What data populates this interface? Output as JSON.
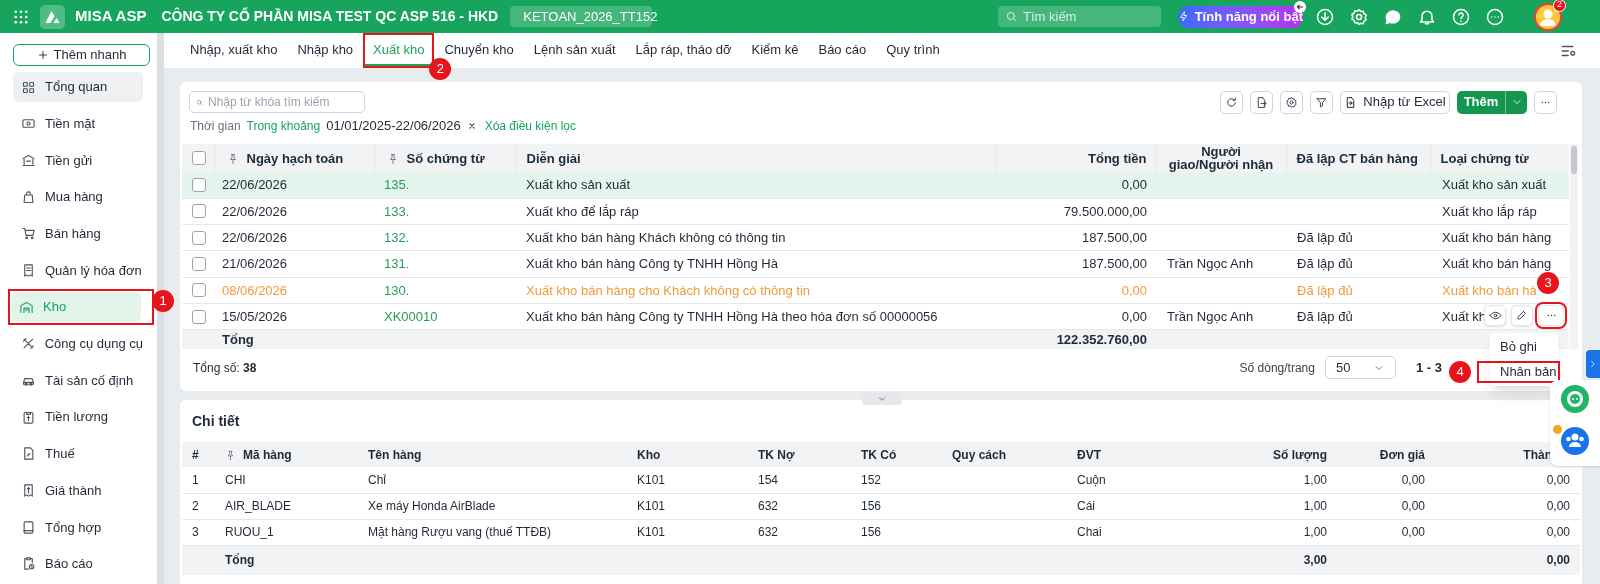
{
  "header": {
    "app_name": "MISA ASP",
    "company": "CÔNG TY CỔ PHẦN MISA TEST QC ASP 516 - HKD",
    "database": "KETOAN_2026_TT152",
    "search": {
      "placeholder": "Tìm kiếm"
    },
    "feature_button": "Tính năng nổi bật",
    "notification_count": "2"
  },
  "sidebar": {
    "quick_add": "Thêm nhanh",
    "items": [
      {
        "label": "Tổng quan",
        "selected": false,
        "hovered": true
      },
      {
        "label": "Tiền mặt",
        "selected": false,
        "hovered": false
      },
      {
        "label": "Tiền gửi",
        "selected": false,
        "hovered": false
      },
      {
        "label": "Mua hàng",
        "selected": false,
        "hovered": false
      },
      {
        "label": "Bán hàng",
        "selected": false,
        "hovered": false
      },
      {
        "label": "Quản lý hóa đơn",
        "selected": false,
        "hovered": false
      },
      {
        "label": "Kho",
        "selected": true,
        "hovered": false,
        "callout": "1"
      },
      {
        "label": "Công cụ dụng cụ",
        "selected": false,
        "hovered": false
      },
      {
        "label": "Tài sản cố định",
        "selected": false,
        "hovered": false
      },
      {
        "label": "Tiền lương",
        "selected": false,
        "hovered": false
      },
      {
        "label": "Thuế",
        "selected": false,
        "hovered": false
      },
      {
        "label": "Giá thành",
        "selected": false,
        "hovered": false
      },
      {
        "label": "Tổng hợp",
        "selected": false,
        "hovered": false
      },
      {
        "label": "Báo cáo",
        "selected": false,
        "hovered": false
      }
    ]
  },
  "tabs": [
    {
      "label": "Nhập, xuất kho",
      "selected": false
    },
    {
      "label": "Nhập kho",
      "selected": false
    },
    {
      "label": "Xuất kho",
      "selected": true,
      "callout": "2"
    },
    {
      "label": "Chuyển kho",
      "selected": false
    },
    {
      "label": "Lệnh sản xuất",
      "selected": false
    },
    {
      "label": "Lắp ráp, tháo dỡ",
      "selected": false
    },
    {
      "label": "Kiểm kê",
      "selected": false
    },
    {
      "label": "Báo cáo",
      "selected": false
    },
    {
      "label": "Quy trình",
      "selected": false
    }
  ],
  "toolbar": {
    "search": {
      "placeholder": "Nhập từ khóa tìm kiếm"
    },
    "import_button": "Nhập từ Excel",
    "add_button": "Thêm"
  },
  "filter": {
    "label": "Thời gian",
    "mode": "Trong khoảng",
    "range": "01/01/2025-22/06/2026",
    "clear": "Xóa điều kiện lọc"
  },
  "vouchers": {
    "all_checked": false,
    "columns": [
      "Ngày hạch toán",
      "Số chứng từ",
      "Diễn giải",
      "Tổng tiền",
      "Người giao/Người nhận",
      "Đã lập CT bán hàng",
      "Loại chứng từ"
    ],
    "rows": [
      {
        "date": "22/06/2026",
        "number": "135.",
        "description": "Xuất kho sản xuất",
        "amount": "0,00",
        "receiver": "",
        "sales_status": "",
        "type": "Xuất kho sản xuất",
        "selected": true,
        "checked": false,
        "kind": "normal"
      },
      {
        "date": "22/06/2026",
        "number": "133.",
        "description": "Xuất kho để lắp ráp",
        "amount": "79.500.000,00",
        "receiver": "",
        "sales_status": "",
        "type": "Xuất kho lắp ráp",
        "selected": false,
        "checked": false,
        "kind": "normal"
      },
      {
        "date": "22/06/2026",
        "number": "132.",
        "description": "Xuất kho bán hàng Khách không có thông tin",
        "amount": "187.500,00",
        "receiver": "",
        "sales_status": "Đã lập đủ",
        "type": "Xuất kho bán hàng",
        "selected": false,
        "checked": false,
        "kind": "normal"
      },
      {
        "date": "21/06/2026",
        "number": "131.",
        "description": "Xuất kho bán hàng Công ty TNHH Hồng Hà",
        "amount": "187.500,00",
        "receiver": "Trần Ngọc Anh",
        "sales_status": "Đã lập đủ",
        "type": "Xuất kho bán hàng",
        "selected": false,
        "checked": false,
        "kind": "normal"
      },
      {
        "date": "08/06/2026",
        "number": "130.",
        "description": "Xuất kho bán hàng cho Khách không có thông tin",
        "amount": "0,00",
        "receiver": "",
        "sales_status": "Đã lập đủ",
        "type": "Xuất kho bán hà",
        "selected": false,
        "checked": false,
        "kind": "unposted"
      },
      {
        "date": "15/05/2026",
        "number": "XK00010",
        "description": "Xuất kho bán hàng Công ty TNHH Hồng Hà theo hóa đơn số 00000056",
        "amount": "0,00",
        "receiver": "Trần Ngọc Anh",
        "sales_status": "Đã lập đủ",
        "type": "Xuất kh",
        "selected": false,
        "checked": false,
        "kind": "normal",
        "actions": {
          "callout": "3",
          "menu": [
            {
              "label": "Bỏ ghi"
            },
            {
              "label": "Nhân bản",
              "callout": "4"
            }
          ]
        }
      }
    ],
    "total_label": "Tổng",
    "total_amount": "122.352.760,00",
    "count_text": "Tổng số: **38**",
    "page_size_label": "Số dòng/trang",
    "page_size": "50",
    "page_range": "1 - 3"
  },
  "details": {
    "title": "Chi tiết",
    "columns": [
      "#",
      "Mã hàng",
      "Tên hàng",
      "Kho",
      "TK Nợ",
      "TK Có",
      "Quy cách",
      "ĐVT",
      "Số lượng",
      "Đơn giá",
      "Thàn"
    ],
    "rows": [
      [
        "1",
        "CHI",
        "Chỉ",
        "K101",
        "154",
        "152",
        "",
        "Cuộn",
        "1,00",
        "0,00",
        "0,00"
      ],
      [
        "2",
        "AIR_BLADE",
        "Xe máy Honda AirBlade",
        "K101",
        "632",
        "156",
        "",
        "Cái",
        "1,00",
        "0,00",
        "0,00"
      ],
      [
        "3",
        "RUOU_1",
        "Mặt hàng Rượu vang (thuế TTĐB)",
        "K101",
        "632",
        "156",
        "",
        "Chai",
        "1,00",
        "0,00",
        "0,00"
      ]
    ],
    "total_label": "Tổng",
    "total_quantity": "3,00",
    "total_last": "0,00"
  }
}
